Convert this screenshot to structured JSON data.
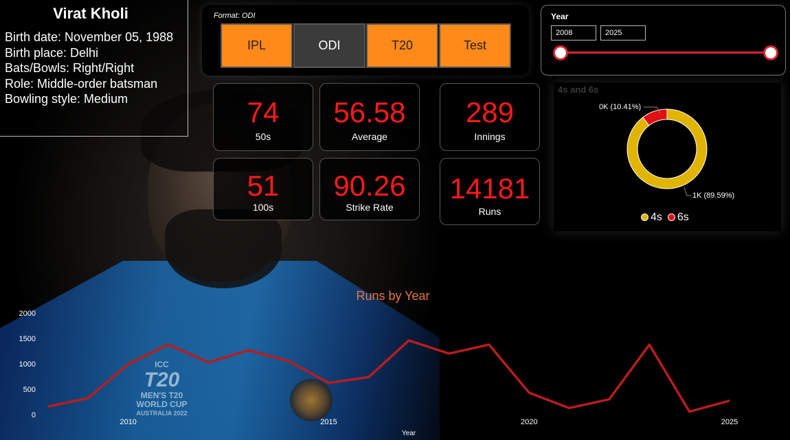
{
  "player": {
    "name": "Virat Kholi",
    "lines": [
      "Birth date: November 05, 1988",
      "Birth place: Delhi",
      "Bats/Bowls: Right/Right",
      "Role: Middle-order batsman",
      "Bowling style: Medium"
    ]
  },
  "format": {
    "label": "Format: ODI",
    "buttons": [
      "IPL",
      "ODI",
      "T20",
      "Test"
    ],
    "active": "ODI"
  },
  "year_slicer": {
    "label": "Year",
    "start": "2008",
    "end": "2025"
  },
  "kpis": [
    {
      "value": "74",
      "label": "50s"
    },
    {
      "value": "56.58",
      "label": "Average"
    },
    {
      "value": "289",
      "label": "Innings"
    },
    {
      "value": "51",
      "label": "100s"
    },
    {
      "value": "90.26",
      "label": "Strike Rate"
    },
    {
      "value": "14181",
      "label": "Runs"
    }
  ],
  "colors": {
    "accent_orange": "#ff8a1a",
    "kpi_red": "#ff1a1a",
    "line_red": "#b81d1d",
    "fours_gold": "#e0b400",
    "sixes_red": "#e01010"
  },
  "background": {
    "logo_line1": "ICC",
    "logo_line2": "T20",
    "logo_line3": "MEN'S T20",
    "logo_line4": "WORLD CUP",
    "logo_line5": "AUSTRALIA 2022"
  },
  "chart_data": [
    {
      "type": "pie",
      "title": "4s and 6s",
      "categories": [
        "4s",
        "6s"
      ],
      "values": [
        89.59,
        10.41
      ],
      "data_labels": [
        "1K (89.59%)",
        "0K (10.41%)"
      ],
      "legend": "bottom"
    },
    {
      "type": "line",
      "title": "Runs by Year",
      "xlabel": "Year",
      "ylabel": "",
      "x": [
        2008,
        2009,
        2010,
        2011,
        2012,
        2013,
        2014,
        2015,
        2016,
        2017,
        2018,
        2019,
        2020,
        2021,
        2022,
        2023,
        2024,
        2025
      ],
      "y": [
        159,
        325,
        995,
        1381,
        1026,
        1268,
        1054,
        623,
        739,
        1460,
        1202,
        1377,
        431,
        129,
        302,
        1377,
        58,
        275
      ],
      "xticks": [
        2010,
        2015,
        2020,
        2025
      ],
      "yticks": [
        0,
        500,
        1000,
        1500,
        2000
      ],
      "ylim": [
        0,
        2000
      ],
      "grid": false
    }
  ]
}
